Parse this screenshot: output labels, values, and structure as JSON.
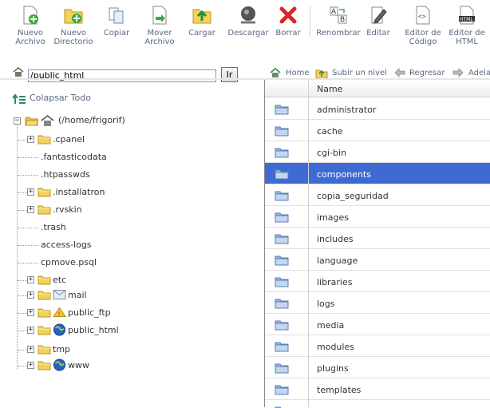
{
  "toolbar": {
    "buttons": [
      {
        "label": "Nuevo\nArchivo",
        "icon": "new-file-icon"
      },
      {
        "label": "Nuevo\nDirectorio",
        "icon": "new-folder-icon"
      },
      {
        "label": "Copiar",
        "icon": "copy-icon"
      },
      {
        "label": "Mover\nArchivo",
        "icon": "move-file-icon"
      },
      {
        "label": "Cargar",
        "icon": "upload-icon"
      },
      {
        "label": "Descargar",
        "icon": "download-icon"
      },
      {
        "label": "Borrar",
        "icon": "delete-icon"
      },
      {
        "label": "Renombrar",
        "icon": "rename-icon"
      },
      {
        "label": "Editar",
        "icon": "edit-icon"
      },
      {
        "label": "Editor de\nCódigo",
        "icon": "code-editor-icon"
      },
      {
        "label": "Editor de\nHTML",
        "icon": "html-editor-icon"
      }
    ]
  },
  "path": {
    "value": "/public_html",
    "go_label": "Ir"
  },
  "nav": {
    "home": "Home",
    "up": "Subir un nivel",
    "back": "Regresar",
    "forward": "Adela"
  },
  "tree": {
    "collapse_label": "Colapsar Todo",
    "root": "(/home/frigorif)",
    "items": [
      {
        "name": ".cpanel",
        "type": "folder",
        "expandable": true
      },
      {
        "name": ".fantasticodata",
        "type": "file",
        "expandable": false
      },
      {
        "name": ".htpasswds",
        "type": "file",
        "expandable": false
      },
      {
        "name": ".installatron",
        "type": "folder",
        "expandable": true
      },
      {
        "name": ".rvskin",
        "type": "folder",
        "expandable": true
      },
      {
        "name": ".trash",
        "type": "file",
        "expandable": false
      },
      {
        "name": "access-logs",
        "type": "file",
        "expandable": false
      },
      {
        "name": "cpmove.psql",
        "type": "file",
        "expandable": false
      },
      {
        "name": "etc",
        "type": "folder",
        "expandable": true
      },
      {
        "name": "mail",
        "type": "mail",
        "expandable": true
      },
      {
        "name": "public_ftp",
        "type": "ftp",
        "expandable": true
      },
      {
        "name": "public_html",
        "type": "web",
        "expandable": true
      },
      {
        "name": "tmp",
        "type": "folder",
        "expandable": true
      },
      {
        "name": "www",
        "type": "web",
        "expandable": true
      }
    ]
  },
  "filelist": {
    "header_name": "Name",
    "selected": "components",
    "rows": [
      "administrator",
      "cache",
      "cgi-bin",
      "components",
      "copia_seguridad",
      "images",
      "includes",
      "language",
      "libraries",
      "logs",
      "media",
      "modules",
      "plugins",
      "templates"
    ]
  },
  "colors": {
    "selection": "#3d6bd3",
    "label": "#5a6a80",
    "folder": "#f2d25a"
  }
}
